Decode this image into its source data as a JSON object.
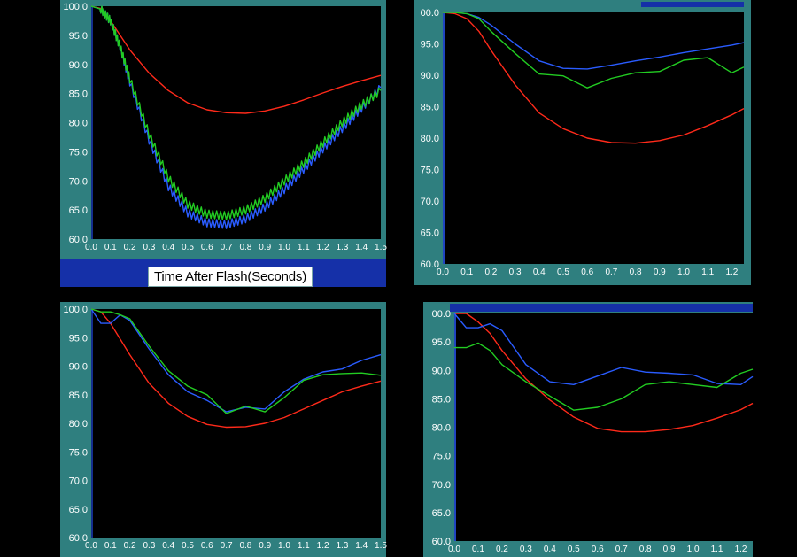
{
  "chart_data": [
    {
      "type": "line",
      "xlabel": "Time After Flash(Seconds)",
      "ylabel": "",
      "xlim": [
        0.0,
        1.5
      ],
      "ylim": [
        60.0,
        100.0
      ],
      "x_ticks": [
        "0.0",
        "0.1",
        "0.2",
        "0.3",
        "0.4",
        "0.5",
        "0.6",
        "0.7",
        "0.8",
        "0.9",
        "1.0",
        "1.1",
        "1.2",
        "1.3",
        "1.4",
        "1.5"
      ],
      "y_ticks": [
        "100.0",
        "95.0",
        "90.0",
        "85.0",
        "80.0",
        "75.0",
        "70.0",
        "65.0",
        "60.0"
      ],
      "series": [
        {
          "color": "#ff2a1a",
          "x": [
            0,
            0.05,
            0.1,
            0.2,
            0.3,
            0.4,
            0.5,
            0.6,
            0.7,
            0.8,
            0.9,
            1.0,
            1.1,
            1.2,
            1.3,
            1.4,
            1.5
          ],
          "y": [
            100,
            99.6,
            97.5,
            92.5,
            88.5,
            85.5,
            83.4,
            82.2,
            81.7,
            81.6,
            82.0,
            82.8,
            83.9,
            85.1,
            86.2,
            87.2,
            88.1
          ]
        },
        {
          "color": "#2a5cff",
          "x": [
            0,
            0.05,
            0.1,
            0.15,
            0.2,
            0.3,
            0.4,
            0.5,
            0.6,
            0.7,
            0.8,
            0.9,
            1.0,
            1.1,
            1.2,
            1.3,
            1.4,
            1.5
          ],
          "y": [
            100,
            99.5,
            97.5,
            93,
            87,
            77,
            69,
            64.5,
            62.8,
            62.5,
            63.5,
            65.5,
            68.5,
            72,
            75.5,
            79,
            82.5,
            86
          ]
        },
        {
          "color": "#22cc22",
          "x": [
            0,
            0.05,
            0.1,
            0.15,
            0.2,
            0.3,
            0.4,
            0.5,
            0.6,
            0.7,
            0.8,
            0.9,
            1.0,
            1.1,
            1.2,
            1.3,
            1.4,
            1.5
          ],
          "y": [
            100,
            99.5,
            97.5,
            93,
            87.5,
            78,
            70.5,
            66,
            64.3,
            64,
            65,
            67,
            70,
            73,
            76.5,
            80,
            83,
            85.5
          ]
        }
      ]
    },
    {
      "type": "line",
      "xlabel": "",
      "ylabel": "",
      "xlim": [
        0.0,
        1.25
      ],
      "ylim": [
        60.0,
        100.0
      ],
      "x_ticks": [
        "0.0",
        "0.1",
        "0.2",
        "0.3",
        "0.4",
        "0.5",
        "0.6",
        "0.7",
        "0.8",
        "0.9",
        "1.0",
        "1.1",
        "1.2"
      ],
      "y_ticks": [
        "00.0",
        "95.0",
        "90.0",
        "85.0",
        "80.0",
        "75.0",
        "70.0",
        "65.0",
        "60.0"
      ],
      "series": [
        {
          "color": "#ff2a1a",
          "x": [
            0,
            0.05,
            0.1,
            0.15,
            0.2,
            0.3,
            0.4,
            0.5,
            0.6,
            0.7,
            0.8,
            0.9,
            1.0,
            1.1,
            1.2,
            1.25
          ],
          "y": [
            100,
            99.8,
            99,
            97,
            94,
            88.5,
            84,
            81.5,
            80,
            79.3,
            79.2,
            79.6,
            80.5,
            82,
            83.7,
            84.7
          ]
        },
        {
          "color": "#2a5cff",
          "x": [
            0,
            0.05,
            0.1,
            0.15,
            0.2,
            0.3,
            0.4,
            0.5,
            0.6,
            0.7,
            0.8,
            0.9,
            1.0,
            1.1,
            1.2,
            1.25
          ],
          "y": [
            100,
            100,
            99.8,
            99.2,
            98,
            95,
            92.3,
            91.1,
            91,
            91.6,
            92.3,
            92.9,
            93.6,
            94.2,
            94.8,
            95.2
          ]
        },
        {
          "color": "#22cc22",
          "x": [
            0,
            0.05,
            0.1,
            0.15,
            0.2,
            0.3,
            0.4,
            0.5,
            0.6,
            0.7,
            0.8,
            0.9,
            1.0,
            1.1,
            1.2,
            1.25
          ],
          "y": [
            100,
            100,
            99.8,
            99,
            97,
            93.5,
            90.2,
            89.9,
            88,
            89.5,
            90.4,
            90.6,
            92.4,
            92.8,
            90.4,
            91.3
          ]
        }
      ]
    },
    {
      "type": "line",
      "xlabel": "",
      "ylabel": "",
      "xlim": [
        0.0,
        1.5
      ],
      "ylim": [
        60.0,
        100.0
      ],
      "x_ticks": [
        "0.0",
        "0.1",
        "0.2",
        "0.3",
        "0.4",
        "0.5",
        "0.6",
        "0.7",
        "0.8",
        "0.9",
        "1.0",
        "1.1",
        "1.2",
        "1.3",
        "1.4",
        "1.5"
      ],
      "y_ticks": [
        "100.0",
        "95.0",
        "90.0",
        "85.0",
        "80.0",
        "75.0",
        "70.0",
        "65.0",
        "60.0"
      ],
      "series": [
        {
          "color": "#ff2a1a",
          "x": [
            0,
            0.05,
            0.1,
            0.2,
            0.3,
            0.4,
            0.5,
            0.6,
            0.7,
            0.8,
            0.9,
            1.0,
            1.1,
            1.2,
            1.3,
            1.4,
            1.5
          ],
          "y": [
            100,
            99.5,
            97.5,
            92,
            87,
            83.5,
            81.2,
            79.8,
            79.3,
            79.4,
            80,
            81,
            82.5,
            84,
            85.5,
            86.5,
            87.4
          ]
        },
        {
          "color": "#2a5cff",
          "x": [
            0,
            0.05,
            0.1,
            0.15,
            0.2,
            0.3,
            0.4,
            0.5,
            0.6,
            0.7,
            0.8,
            0.9,
            1.0,
            1.1,
            1.2,
            1.3,
            1.4,
            1.5
          ],
          "y": [
            100,
            97.5,
            97.5,
            99,
            98,
            93,
            88.5,
            85.5,
            84,
            82,
            82.8,
            82.5,
            85.5,
            87.7,
            89,
            89.5,
            91,
            92
          ]
        },
        {
          "color": "#22cc22",
          "x": [
            0,
            0.05,
            0.1,
            0.15,
            0.2,
            0.3,
            0.4,
            0.5,
            0.6,
            0.7,
            0.8,
            0.9,
            1.0,
            1.1,
            1.2,
            1.3,
            1.4,
            1.5
          ],
          "y": [
            100,
            99.5,
            99.5,
            99,
            98.3,
            93.5,
            89.2,
            86.5,
            85,
            81.7,
            83,
            82,
            84.5,
            87.5,
            88.5,
            88.7,
            88.8,
            88.4
          ]
        }
      ]
    },
    {
      "type": "line",
      "xlabel": "",
      "ylabel": "",
      "xlim": [
        0.0,
        1.25
      ],
      "ylim": [
        60.0,
        100.0
      ],
      "x_ticks": [
        "0.0",
        "0.1",
        "0.2",
        "0.3",
        "0.4",
        "0.5",
        "0.6",
        "0.7",
        "0.8",
        "0.9",
        "1.0",
        "1.1",
        "1.2"
      ],
      "y_ticks": [
        "00.0",
        "95.0",
        "90.0",
        "85.0",
        "80.0",
        "75.0",
        "70.0",
        "65.0",
        "60.0"
      ],
      "series": [
        {
          "color": "#ff2a1a",
          "x": [
            0,
            0.05,
            0.1,
            0.15,
            0.2,
            0.3,
            0.4,
            0.5,
            0.6,
            0.7,
            0.8,
            0.9,
            1.0,
            1.1,
            1.2,
            1.25
          ],
          "y": [
            100,
            100,
            98.5,
            96.5,
            93.5,
            88.5,
            84.8,
            81.8,
            79.8,
            79.2,
            79.2,
            79.6,
            80.3,
            81.6,
            83.1,
            84.2
          ]
        },
        {
          "color": "#2a5cff",
          "x": [
            0,
            0.05,
            0.1,
            0.15,
            0.2,
            0.3,
            0.4,
            0.5,
            0.6,
            0.7,
            0.8,
            0.9,
            1.0,
            1.1,
            1.2,
            1.25
          ],
          "y": [
            100,
            97.5,
            97.5,
            98.2,
            97,
            91,
            88,
            87.5,
            89,
            90.5,
            89.7,
            89.5,
            89.2,
            87.7,
            87.5,
            88.9
          ]
        },
        {
          "color": "#22cc22",
          "x": [
            0,
            0.05,
            0.1,
            0.15,
            0.2,
            0.3,
            0.4,
            0.5,
            0.6,
            0.7,
            0.8,
            0.9,
            1.0,
            1.1,
            1.2,
            1.25
          ],
          "y": [
            94,
            94,
            94.8,
            93.5,
            91,
            88,
            85.5,
            83,
            83.5,
            85,
            87.5,
            88,
            87.5,
            87,
            89.5,
            90.2
          ]
        }
      ]
    }
  ]
}
